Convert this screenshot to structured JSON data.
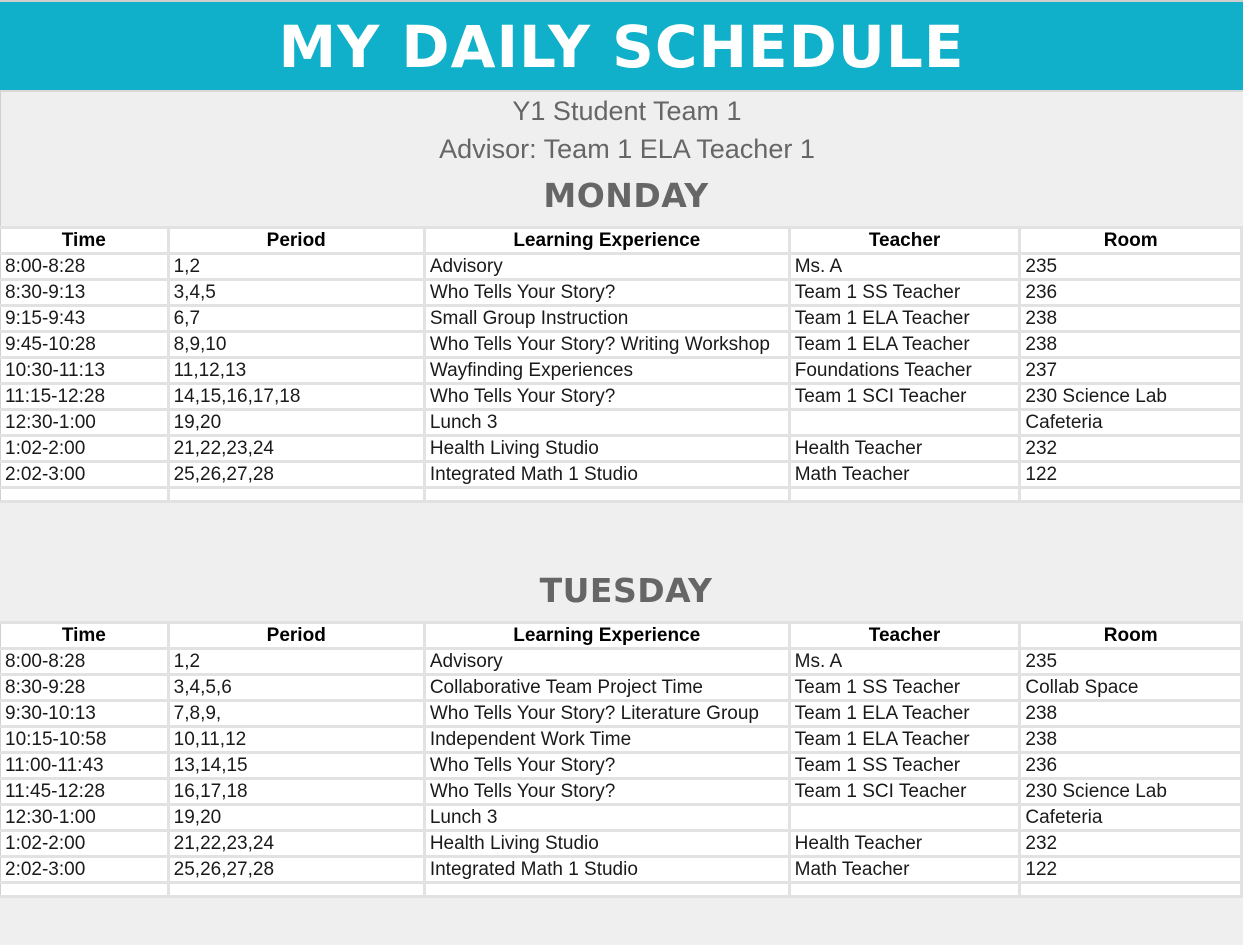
{
  "header": {
    "title": "MY DAILY SCHEDULE",
    "student": "Y1 Student Team 1",
    "advisor": "Advisor: Team 1 ELA Teacher 1",
    "accent_color": "#10afca"
  },
  "columns": [
    "Time",
    "Period",
    "Learning Experience",
    "Teacher",
    "Room"
  ],
  "days": [
    {
      "name": "MONDAY",
      "rows": [
        {
          "time": "8:00-8:28",
          "period": "1,2",
          "experience": "Advisory",
          "teacher": "Ms. A",
          "room": "235"
        },
        {
          "time": "8:30-9:13",
          "period": "3,4,5",
          "experience": "Who Tells Your Story?",
          "teacher": "Team 1 SS Teacher",
          "room": "236"
        },
        {
          "time": "9:15-9:43",
          "period": "6,7",
          "experience": "Small Group Instruction",
          "teacher": "Team 1 ELA Teacher",
          "room": "238"
        },
        {
          "time": "9:45-10:28",
          "period": "8,9,10",
          "experience": "Who Tells Your Story? Writing Workshop",
          "teacher": "Team 1 ELA Teacher",
          "room": "238"
        },
        {
          "time": "10:30-11:13",
          "period": "11,12,13",
          "experience": "Wayfinding Experiences",
          "teacher": "Foundations Teacher",
          "room": "237"
        },
        {
          "time": "11:15-12:28",
          "period": "14,15,16,17,18",
          "experience": "Who Tells Your Story?",
          "teacher": "Team 1 SCI Teacher",
          "room": "230 Science Lab"
        },
        {
          "time": "12:30-1:00",
          "period": "19,20",
          "experience": "Lunch 3",
          "teacher": "",
          "room": "Cafeteria"
        },
        {
          "time": "1:02-2:00",
          "period": "21,22,23,24",
          "experience": "Health Living Studio",
          "teacher": "Health Teacher",
          "room": "232"
        },
        {
          "time": "2:02-3:00",
          "period": "25,26,27,28",
          "experience": "Integrated Math 1 Studio",
          "teacher": "Math Teacher",
          "room": "122"
        },
        {
          "time": "",
          "period": "",
          "experience": "",
          "teacher": "",
          "room": ""
        }
      ]
    },
    {
      "name": "TUESDAY",
      "rows": [
        {
          "time": "8:00-8:28",
          "period": "1,2",
          "experience": "Advisory",
          "teacher": "Ms. A",
          "room": "235"
        },
        {
          "time": "8:30-9:28",
          "period": "3,4,5,6",
          "experience": "Collaborative Team Project Time",
          "teacher": "Team 1 SS Teacher",
          "room": "Collab Space"
        },
        {
          "time": "9:30-10:13",
          "period": "7,8,9,",
          "experience": "Who Tells Your Story? Literature Group",
          "teacher": "Team 1 ELA Teacher",
          "room": "238"
        },
        {
          "time": "10:15-10:58",
          "period": "10,11,12",
          "experience": "Independent Work Time",
          "teacher": "Team 1 ELA Teacher",
          "room": "238"
        },
        {
          "time": "11:00-11:43",
          "period": "13,14,15",
          "experience": "Who Tells Your Story?",
          "teacher": "Team 1 SS Teacher",
          "room": "236"
        },
        {
          "time": "11:45-12:28",
          "period": "16,17,18",
          "experience": "Who Tells Your Story?",
          "teacher": "Team 1 SCI Teacher",
          "room": "230 Science Lab"
        },
        {
          "time": "12:30-1:00",
          "period": "19,20",
          "experience": "Lunch 3",
          "teacher": "",
          "room": "Cafeteria"
        },
        {
          "time": "1:02-2:00",
          "period": "21,22,23,24",
          "experience": "Health Living Studio",
          "teacher": "Health Teacher",
          "room": "232"
        },
        {
          "time": "2:02-3:00",
          "period": "25,26,27,28",
          "experience": "Integrated Math 1 Studio",
          "teacher": "Math Teacher",
          "room": "122"
        },
        {
          "time": "",
          "period": "",
          "experience": "",
          "teacher": "",
          "room": ""
        }
      ]
    }
  ]
}
